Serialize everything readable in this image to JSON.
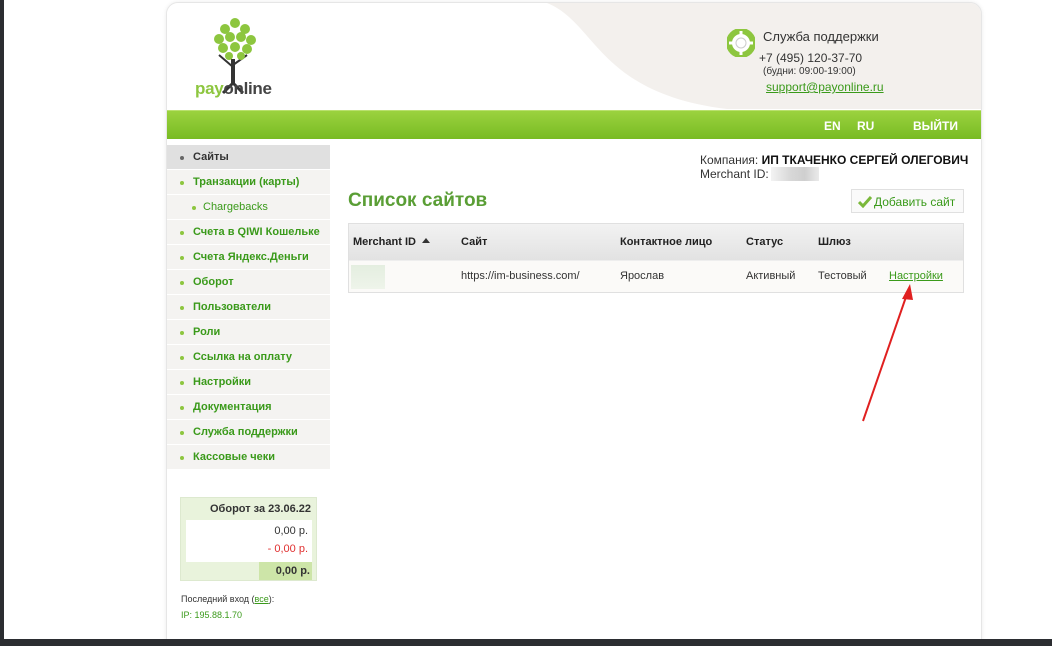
{
  "brand": {
    "pay": "pay",
    "online": "online"
  },
  "support": {
    "title": "Служба поддержки",
    "phone": "+7 (495) 120-37-70",
    "hours": "(будни: 09:00-19:00)",
    "email": "support@payonline.ru"
  },
  "topbar": {
    "lang_en": "EN",
    "lang_ru": "RU",
    "logout": "ВЫЙТИ"
  },
  "sidebar": {
    "items": [
      {
        "label": "Сайты"
      },
      {
        "label": "Транзакции (карты)"
      },
      {
        "label": "Chargebacks"
      },
      {
        "label": "Счета в QIWI Кошельке"
      },
      {
        "label": "Счета Яндекс.Деньги"
      },
      {
        "label": "Оборот"
      },
      {
        "label": "Пользователи"
      },
      {
        "label": "Роли"
      },
      {
        "label": "Ссылка на оплату"
      },
      {
        "label": "Настройки"
      },
      {
        "label": "Документация"
      },
      {
        "label": "Служба поддержки"
      },
      {
        "label": "Кассовые чеки"
      }
    ]
  },
  "turnover": {
    "title": "Оборот за 23.06.22",
    "plus": "0,00 р.",
    "minus": "- 0,00 р.",
    "total": "0,00 р."
  },
  "last_login": {
    "prefix": "Последний вход (",
    "link": "все",
    "suffix": "):",
    "ip": "IP: 195.88.1.70"
  },
  "company": {
    "label": "Компания: ",
    "name": "ИП ТКАЧЕНКО СЕРГЕЙ ОЛЕГОВИЧ",
    "merchant_label": "Merchant ID:"
  },
  "page": {
    "title": "Список сайтов",
    "add_button": "Добавить сайт"
  },
  "table": {
    "headers": [
      "Merchant ID",
      "Сайт",
      "Контактное лицо",
      "Статус",
      "Шлюз",
      ""
    ],
    "rows": [
      {
        "merchant_id": "",
        "site": "https://im-business.com/",
        "contact": "Ярослав",
        "status": "Активный",
        "gateway": "Тестовый",
        "action": "Настройки"
      }
    ]
  },
  "colors": {
    "accent_green": "#8dc63f",
    "link_green": "#3a9a1a",
    "title_green": "#5a9e35",
    "annotation_red": "#e02020"
  }
}
